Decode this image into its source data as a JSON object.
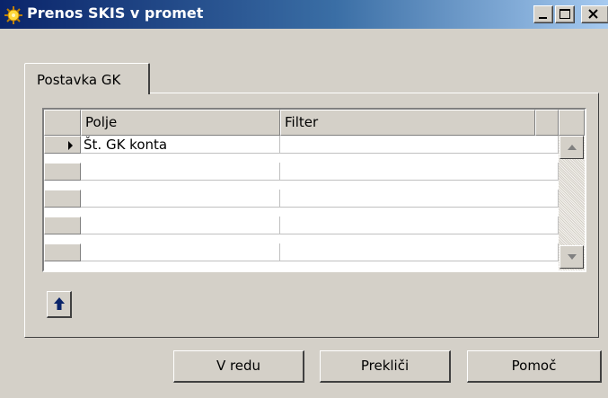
{
  "window": {
    "title": "Prenos SKIS v promet",
    "title_bar_color": "#0a246a",
    "icon": "sun-gear-icon",
    "controls": [
      "minimize-icon",
      "maximize-icon",
      "close-icon"
    ]
  },
  "tab": {
    "label": "Postavka GK"
  },
  "grid": {
    "columns": [
      "Polje",
      "Filter"
    ],
    "rows": [
      {
        "polje": "Št. GK konta",
        "filter": "",
        "current": true
      },
      {
        "polje": "",
        "filter": ""
      },
      {
        "polje": "",
        "filter": ""
      },
      {
        "polje": "",
        "filter": ""
      },
      {
        "polje": "",
        "filter": ""
      }
    ]
  },
  "move_up_icon": "arrow-up-icon",
  "buttons": {
    "ok": "V redu",
    "cancel": "Prekliči",
    "help": "Pomoč"
  }
}
